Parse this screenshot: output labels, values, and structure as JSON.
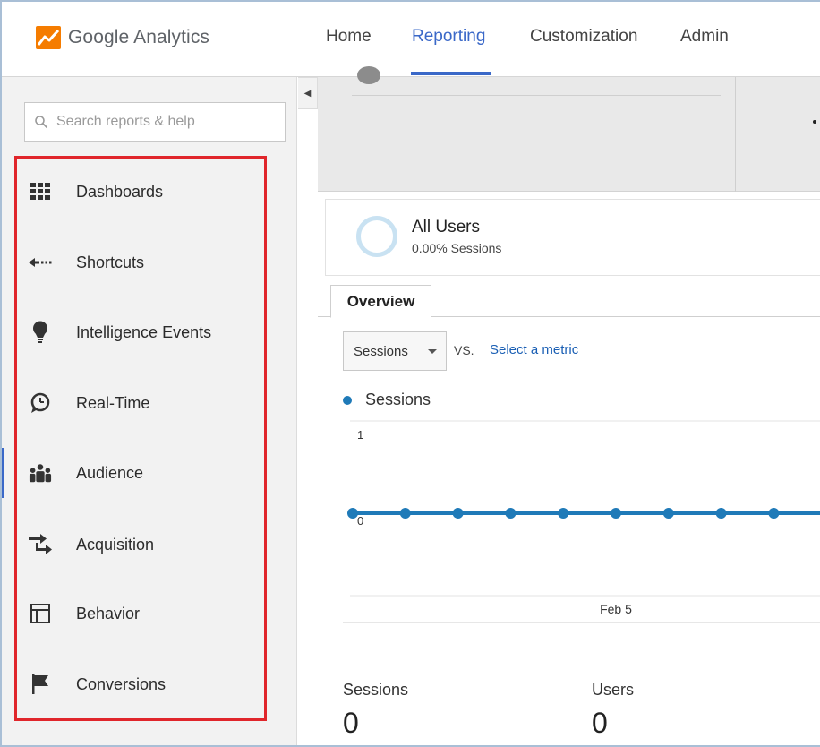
{
  "app": {
    "name": "Google Analytics",
    "brand_color": "#f57c00"
  },
  "nav": {
    "items": [
      "Home",
      "Reporting",
      "Customization",
      "Admin"
    ],
    "active": "Reporting",
    "active_color": "#3a68c8"
  },
  "sidebar": {
    "search_placeholder": "Search reports & help",
    "items": [
      {
        "label": "Dashboards",
        "icon": "grid-icon"
      },
      {
        "label": "Shortcuts",
        "icon": "arrow-left-dotted-icon"
      },
      {
        "label": "Intelligence Events",
        "icon": "lightbulb-icon"
      },
      {
        "label": "Real-Time",
        "icon": "clock-bubble-icon"
      },
      {
        "label": "Audience",
        "icon": "people-icon"
      },
      {
        "label": "Acquisition",
        "icon": "transfer-arrows-icon"
      },
      {
        "label": "Behavior",
        "icon": "layout-icon"
      },
      {
        "label": "Conversions",
        "icon": "flag-icon"
      }
    ],
    "highlight_color": "#e0262b"
  },
  "segment": {
    "title": "All Users",
    "subtitle": "0.00% Sessions"
  },
  "tabs": {
    "active": "Overview"
  },
  "controls": {
    "metric": "Sessions",
    "vs_label": "VS.",
    "compare_link": "Select a metric"
  },
  "chart_data": {
    "type": "line",
    "series": [
      {
        "name": "Sessions",
        "color": "#1f7ab8",
        "values": [
          0,
          0,
          0,
          0,
          0,
          0,
          0,
          0,
          0
        ]
      }
    ],
    "ylim": [
      0,
      1
    ],
    "y_ticks": [
      "1",
      "0"
    ],
    "x_label_visible": "Feb 5"
  },
  "metrics": [
    {
      "name": "Sessions",
      "value": "0"
    },
    {
      "name": "Users",
      "value": "0"
    }
  ]
}
